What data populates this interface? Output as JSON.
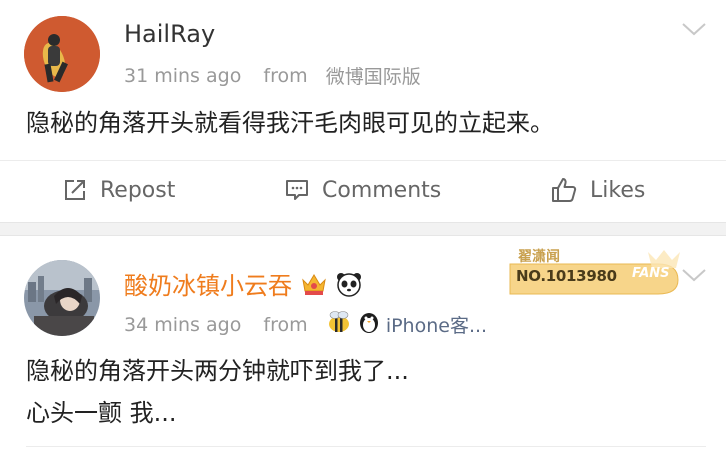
{
  "posts": [
    {
      "username": "HailRay",
      "time": "31 mins ago",
      "from_label": "from",
      "source": "微博国际版",
      "content": "隐秘的角落开头就看得我汗毛肉眼可见的立起来。"
    },
    {
      "username": "酸奶冰镇小云吞",
      "time": "34 mins ago",
      "from_label": "from",
      "source": "iPhone客...",
      "content_lines": [
        "隐秘的角落开头两分钟就吓到我了...",
        "心头一颤 我..."
      ],
      "fans_badge": {
        "title": "翟潇闻",
        "number": "NO.1013980",
        "word": "FANS"
      }
    }
  ],
  "actions": {
    "repost": "Repost",
    "comments": "Comments",
    "likes": "Likes"
  },
  "colors": {
    "meta": "#999999",
    "source": "#5b6b86",
    "username2": "#ef7c1d",
    "badge_gold": "#f3c56a"
  },
  "icons": [
    "chevron-down-icon",
    "repost-icon",
    "comment-icon",
    "like-icon",
    "crown-icon",
    "panda-icon",
    "bee-icon",
    "penguin-icon"
  ]
}
